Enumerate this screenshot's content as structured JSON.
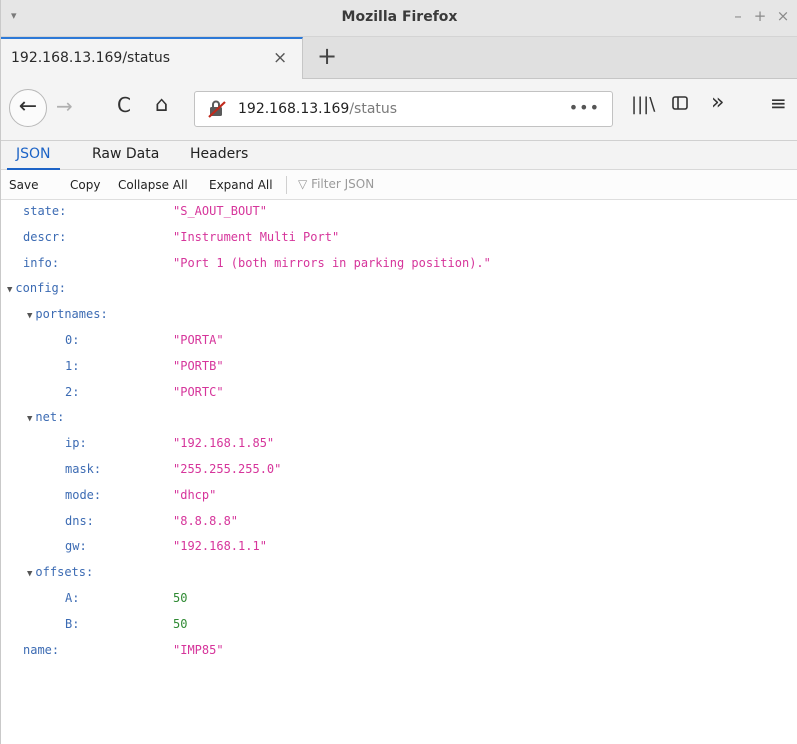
{
  "window": {
    "title": "Mozilla Firefox",
    "menu_icon": "▾",
    "minimize_icon": "–",
    "maximize_icon": "+",
    "close_icon": "×"
  },
  "tab": {
    "title": "192.168.13.169/status",
    "close_icon": "×",
    "new_tab_icon": "+"
  },
  "nav": {
    "back_icon": "←",
    "forward_icon": "→",
    "reload_icon": "C",
    "home_icon": "⌂",
    "insecure_icon": "no-lock-icon",
    "url_host": "192.168.13.169",
    "url_path": "/status",
    "page_actions_icon": "•••",
    "library_icon": "|||\\",
    "sidebar_icon": "▯",
    "overflow_icon": "»",
    "menu_icon": "≡"
  },
  "viewer": {
    "tabs": [
      {
        "label": "JSON",
        "active": true
      },
      {
        "label": "Raw Data",
        "active": false
      },
      {
        "label": "Headers",
        "active": false
      }
    ],
    "actions": {
      "save": "Save",
      "copy": "Copy",
      "collapse_all": "Collapse All",
      "expand_all": "Expand All",
      "filter_placeholder": "Filter JSON",
      "filter_icon": "▽"
    }
  },
  "json_rows": [
    {
      "key": "state:",
      "value": "\"S_AOUT_BOUT\"",
      "type": "str",
      "depth": 0
    },
    {
      "key": "descr:",
      "value": "\"Instrument Multi Port\"",
      "type": "str",
      "depth": 0
    },
    {
      "key": "info:",
      "value": "\"Port 1 (both mirrors in parking position).\"",
      "type": "str",
      "depth": 0
    },
    {
      "key": "config:",
      "value": "",
      "type": "obj",
      "depth": 0
    },
    {
      "key": "portnames:",
      "value": "",
      "type": "obj",
      "depth": 1
    },
    {
      "key": "0:",
      "value": "\"PORTA\"",
      "type": "str",
      "depth": 2
    },
    {
      "key": "1:",
      "value": "\"PORTB\"",
      "type": "str",
      "depth": 2
    },
    {
      "key": "2:",
      "value": "\"PORTC\"",
      "type": "str",
      "depth": 2
    },
    {
      "key": "net:",
      "value": "",
      "type": "obj",
      "depth": 1
    },
    {
      "key": "ip:",
      "value": "\"192.168.1.85\"",
      "type": "str",
      "depth": 2
    },
    {
      "key": "mask:",
      "value": "\"255.255.255.0\"",
      "type": "str",
      "depth": 2
    },
    {
      "key": "mode:",
      "value": "\"dhcp\"",
      "type": "str",
      "depth": 2
    },
    {
      "key": "dns:",
      "value": "\"8.8.8.8\"",
      "type": "str",
      "depth": 2
    },
    {
      "key": "gw:",
      "value": "\"192.168.1.1\"",
      "type": "str",
      "depth": 2
    },
    {
      "key": "offsets:",
      "value": "",
      "type": "obj",
      "depth": 1
    },
    {
      "key": "A:",
      "value": "50",
      "type": "num",
      "depth": 2
    },
    {
      "key": "B:",
      "value": "50",
      "type": "num",
      "depth": 2
    },
    {
      "key": "name:",
      "value": "\"IMP85\"",
      "type": "str",
      "depth": 0
    }
  ],
  "colors": {
    "key": "#3c6bb3",
    "string": "#d6359b",
    "number": "#2f8a33",
    "active_tab": "#1c63c6"
  }
}
